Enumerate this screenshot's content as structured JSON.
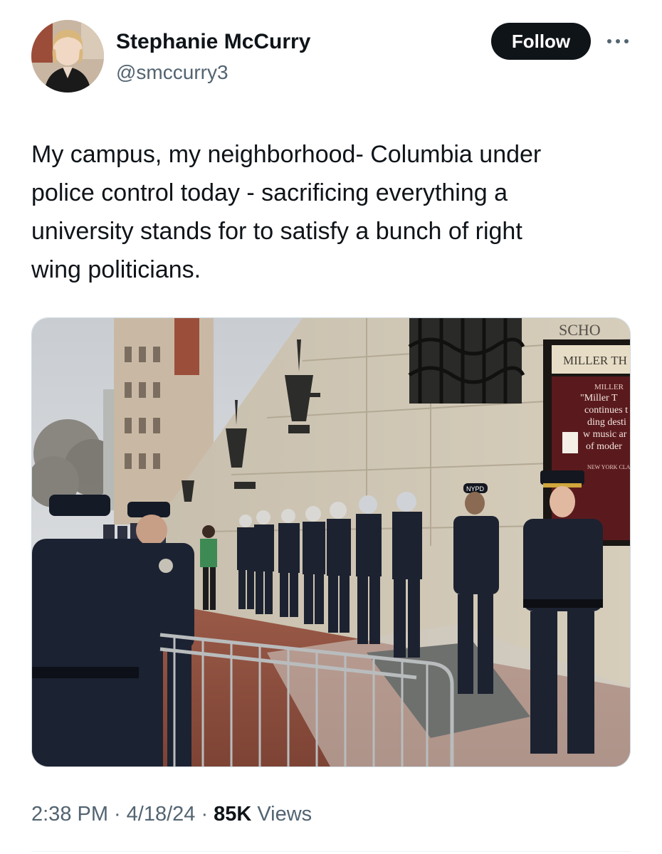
{
  "author": {
    "name": "Stephanie McCurry",
    "handle": "@smccurry3"
  },
  "follow_label": "Follow",
  "tweet": {
    "lines": [
      "My campus, my neighborhood- Columbia under",
      "police control today - sacrificing everything a",
      "university stands for to satisfy a bunch of right",
      "wing politicians."
    ]
  },
  "media": {
    "sign_top": "SCHO",
    "sign_name": "MILLER TH",
    "poster_title": "MILLER",
    "poster_lines": [
      "\"Miller T",
      "continues t",
      "ding desti",
      "w music ar",
      "of moder"
    ],
    "poster_footer": "NEW YORK CLAS",
    "cap_badge": "NYPD"
  },
  "meta": {
    "time": "2:38 PM",
    "date": "4/18/24",
    "views_count": "85K",
    "views_label": "Views"
  },
  "colors": {
    "follow_bg": "#0f1419",
    "secondary_text": "#536471",
    "uniform": "#1c2230"
  }
}
